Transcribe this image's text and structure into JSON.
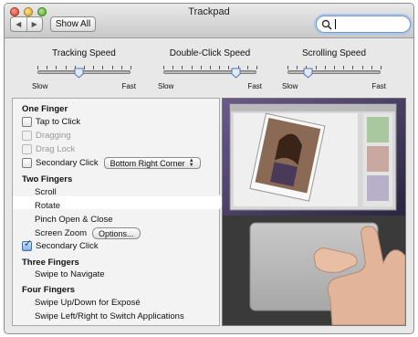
{
  "window": {
    "title": "Trackpad"
  },
  "toolbar": {
    "back_glyph": "◀",
    "forward_glyph": "▶",
    "show_all_label": "Show All",
    "search_value": "",
    "search_icon": "magnifier-icon"
  },
  "sliders": [
    {
      "label": "Tracking Speed",
      "min_label": "Slow",
      "max_label": "Fast",
      "level": 0.45
    },
    {
      "label": "Double-Click Speed",
      "min_label": "Slow",
      "max_label": "Fast",
      "level": 0.78
    },
    {
      "label": "Scrolling Speed",
      "min_label": "Slow",
      "max_label": "Fast",
      "level": 0.22
    }
  ],
  "gestures": {
    "one_finger": {
      "heading": "One Finger",
      "tap_to_click": {
        "label": "Tap to Click",
        "checked": false,
        "enabled": true
      },
      "dragging": {
        "label": "Dragging",
        "checked": false,
        "enabled": false
      },
      "drag_lock": {
        "label": "Drag Lock",
        "checked": false,
        "enabled": false
      },
      "secondary_click": {
        "label": "Secondary Click",
        "checked": false,
        "enabled": true,
        "option": "Bottom Right Corner"
      }
    },
    "two_fingers": {
      "heading": "Two Fingers",
      "scroll": "Scroll",
      "rotate": "Rotate",
      "pinch": "Pinch Open & Close",
      "screen_zoom": "Screen Zoom",
      "options_label": "Options...",
      "secondary_click": {
        "label": "Secondary Click",
        "checked": true
      }
    },
    "three_fingers": {
      "heading": "Three Fingers",
      "swipe": "Swipe to Navigate"
    },
    "four_fingers": {
      "heading": "Four Fingers",
      "swipe_expose": "Swipe Up/Down for Exposé",
      "swipe_apps": "Swipe Left/Right to Switch Applications"
    },
    "selected_item": "Rotate"
  },
  "colors": {
    "accent_focus": "#a9c6ec",
    "selected_row": "#ffffff",
    "checkbox_checked": "#7fb0ea"
  }
}
